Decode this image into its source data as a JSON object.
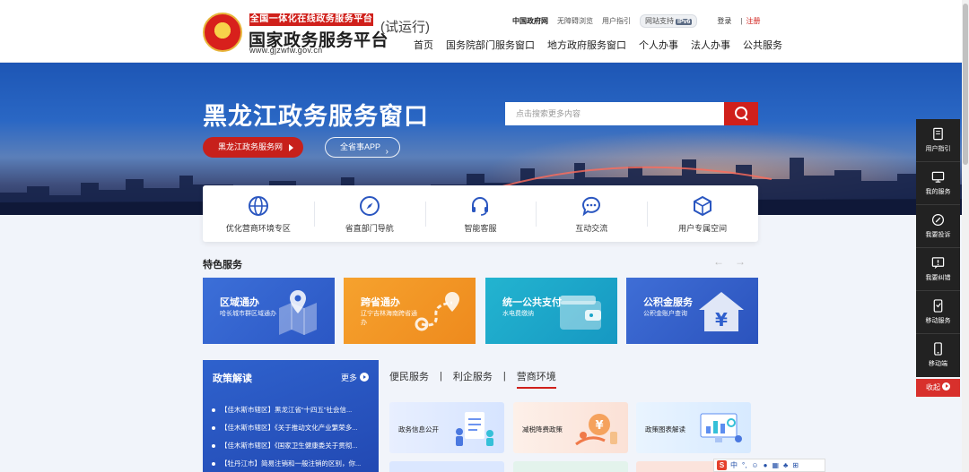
{
  "header": {
    "brand_tag": "全国一体化在线政务服务平台",
    "brand_title": "国家政务服务平台",
    "brand_url": "www.gjzwfw.gov.cn",
    "trial_label": "(试运行)",
    "top_links": {
      "gov_net": "中国政府网",
      "accessible": "无障碍浏览",
      "guide": "用户指引",
      "site_support": "网站支持",
      "ipv6": "IPv6",
      "login": "登录",
      "separator": "|",
      "register": "注册"
    },
    "nav": [
      "首页",
      "国务院部门服务窗口",
      "地方政府服务窗口",
      "个人办事",
      "法人办事",
      "公共服务"
    ]
  },
  "banner": {
    "title": "黑龙江政务服务窗口",
    "search_placeholder": "点击搜索更多内容",
    "portal_button": "黑龙江政务服务网",
    "app_button": "全省事APP",
    "app_chevron": "›"
  },
  "quick_nav": [
    {
      "label": "优化营商环境专区",
      "icon": "globe-icon"
    },
    {
      "label": "省直部门导航",
      "icon": "compass-icon"
    },
    {
      "label": "智能客服",
      "icon": "headset-icon"
    },
    {
      "label": "互动交流",
      "icon": "chat-icon"
    },
    {
      "label": "用户专属空间",
      "icon": "cube-icon"
    }
  ],
  "featured": {
    "title": "特色服务",
    "prev_arrow": "←",
    "next_arrow": "→",
    "tiles": [
      {
        "title": "区域通办",
        "desc": "哈长城市群区域通办",
        "icon": "map-pin-icon"
      },
      {
        "title": "跨省通办",
        "desc": "辽宁吉林海南跨省通办",
        "icon": "route-icon"
      },
      {
        "title": "统一公共支付",
        "desc": "水电费缴纳",
        "icon": "wallet-icon"
      },
      {
        "title": "公积金服务",
        "desc": "公积金账户查询",
        "icon": "yuan-house-icon"
      }
    ]
  },
  "policy": {
    "title": "政策解读",
    "more": "更多",
    "items": [
      "【佳木斯市辖区】黑龙江省“十四五”社会信...",
      "【佳木斯市辖区】《关于推动文化产业繁荣多...",
      "【佳木斯市辖区】《国家卫生健康委关于贯彻...",
      "【牡丹江市】简易注销和一般注销的区别，你..."
    ]
  },
  "tabs": {
    "items": [
      "便民服务",
      "利企服务",
      "营商环境"
    ],
    "separator": "|",
    "active_index": 2,
    "cards": [
      {
        "label": "政务信息公开",
        "icon": "document-people-icon"
      },
      {
        "label": "减税降费政策",
        "icon": "tax-coin-icon"
      },
      {
        "label": "政策图表解读",
        "icon": "dashboard-chart-icon"
      }
    ]
  },
  "sidebar": [
    {
      "label": "用户指引",
      "icon": "guide-book-icon"
    },
    {
      "label": "我的服务",
      "icon": "monitor-icon"
    },
    {
      "label": "我要投诉",
      "icon": "complaint-icon"
    },
    {
      "label": "我要纠错",
      "icon": "correction-icon"
    },
    {
      "label": "移动服务",
      "icon": "mobile-service-icon"
    },
    {
      "label": "移动端",
      "icon": "phone-icon"
    }
  ],
  "feedback": "收起",
  "ime": {
    "badge": "S",
    "mode": "中",
    "punct": "°,"
  },
  "colors": {
    "brand_red": "#d0201b",
    "banner_blue": "#2a67c4",
    "sidebar_dark": "#222222"
  }
}
